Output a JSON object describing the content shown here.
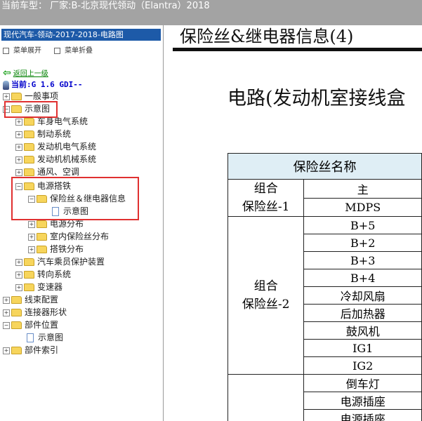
{
  "topbar": {
    "text": "当前车型： 厂家:B-北京现代领动（Elantra）2018"
  },
  "left": {
    "title": "现代汽车-领动-2017-2018-电路图",
    "expand_all": "菜单展开",
    "collapse_all": "菜单折叠",
    "back": "返回上一级",
    "current": "当前:G 1.6 GDI--",
    "tree": [
      {
        "label": "一般事项",
        "sign": "+"
      },
      {
        "label": "示意图",
        "sign": "−"
      },
      {
        "label": "车身电气系统",
        "sign": "+"
      },
      {
        "label": "制动系统",
        "sign": "+"
      },
      {
        "label": "发动机电气系统",
        "sign": "+"
      },
      {
        "label": "发动机机械系统",
        "sign": "+"
      },
      {
        "label": "通风、空调",
        "sign": "+"
      },
      {
        "label": "电源搭铁",
        "sign": "−"
      },
      {
        "label": "保险丝＆继电器信息",
        "sign": "−"
      },
      {
        "label": "示意图",
        "sign": ""
      },
      {
        "label": "电源分布",
        "sign": "+"
      },
      {
        "label": "室内保险丝分布",
        "sign": "+"
      },
      {
        "label": "搭铁分布",
        "sign": "+"
      },
      {
        "label": "汽车乘员保护装置",
        "sign": "+"
      },
      {
        "label": "转向系统",
        "sign": "+"
      },
      {
        "label": "变速器",
        "sign": "+"
      },
      {
        "label": "线束配置",
        "sign": "+"
      },
      {
        "label": "连接器形状",
        "sign": "+"
      },
      {
        "label": "部件位置",
        "sign": "−"
      },
      {
        "label": "示意图",
        "sign": ""
      },
      {
        "label": "部件索引",
        "sign": "+"
      }
    ]
  },
  "content": {
    "title": "保险丝&继电器信息(4)",
    "subtitle": "电路(发动机室接线盒",
    "table_header": "保险丝名称",
    "groups": [
      {
        "name_line1": "组合",
        "name_line2": "保险丝-1",
        "items": [
          "主",
          "MDPS"
        ]
      },
      {
        "name_line1": "组合",
        "name_line2": "保险丝-2",
        "items": [
          "B+5",
          "B+2",
          "B+3",
          "B+4",
          "冷却风扇",
          "后加热器",
          "鼓风机",
          "IG1",
          "IG2"
        ]
      },
      {
        "name_line1": "",
        "name_line2": "",
        "items": [
          "倒车灯",
          "电源插座",
          "电源插座"
        ]
      }
    ]
  },
  "colors": {
    "topbar": "#a3a3a3",
    "left_title_bg": "#1d5aa8",
    "highlight": "#e03030",
    "table_header_bg": "#dfeef5"
  }
}
